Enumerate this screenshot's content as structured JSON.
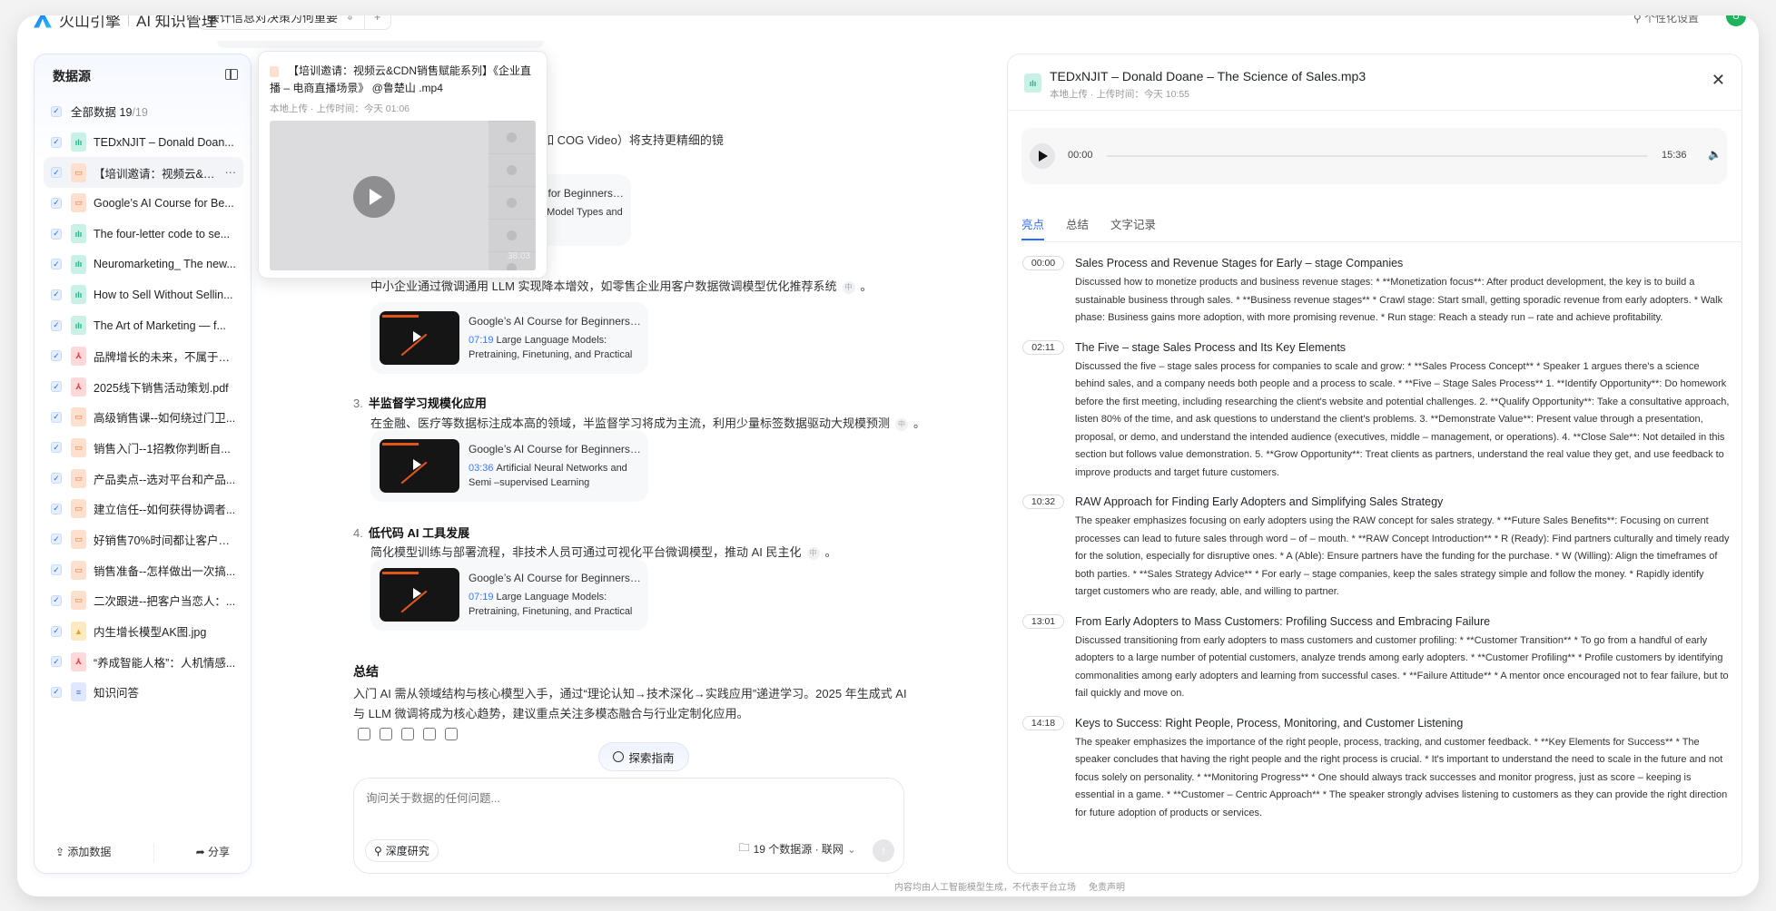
{
  "header": {
    "brand": "火山引擎",
    "app": "AI 知识管理",
    "session_tab": "会计信息对决策为何重要",
    "add_tab": "+",
    "personalize": "个性化设置",
    "avatar": "U"
  },
  "sidebar": {
    "title": "数据源",
    "all": {
      "label": "全部数据",
      "selected": "19",
      "total": "/19"
    },
    "items": [
      {
        "name": "TEDxNJIT – Donald Doan...",
        "type": "audio"
      },
      {
        "name": "【培训邀请：视频云&C...",
        "type": "video",
        "active": true,
        "more": "···"
      },
      {
        "name": "Google’s AI Course for Be...",
        "type": "video"
      },
      {
        "name": "The four-letter code to se...",
        "type": "audio"
      },
      {
        "name": "Neuromarketing_ The new...",
        "type": "audio"
      },
      {
        "name": "How to Sell Without Sellin...",
        "type": "audio"
      },
      {
        "name": "The Art of Marketing — f...",
        "type": "audio"
      },
      {
        "name": "品牌增长的未来，不属于渠...",
        "type": "pdf"
      },
      {
        "name": "2025线下销售活动策划.pdf",
        "type": "pdf"
      },
      {
        "name": "高级销售课--如何绕过门卫...",
        "type": "video"
      },
      {
        "name": "销售入门--1招教你判断自...",
        "type": "video"
      },
      {
        "name": "产品卖点--选对平台和产品...",
        "type": "video"
      },
      {
        "name": "建立信任--如何获得协调者...",
        "type": "video"
      },
      {
        "name": "好销售70%时间都让客户说...",
        "type": "video"
      },
      {
        "name": "销售准备--怎样做出一次搞...",
        "type": "video"
      },
      {
        "name": "二次跟进--把客户当恋人：...",
        "type": "video"
      },
      {
        "name": "内生增长模型AK图.jpg",
        "type": "image"
      },
      {
        "name": "“养成智能人格”：人机情感...",
        "type": "pdf"
      },
      {
        "name": "知识问答",
        "type": "doc"
      }
    ],
    "add_data": "添加数据",
    "share": "分享"
  },
  "popover": {
    "title": "【培训邀请：视频云&CDN销售赋能系列】《企业直播 – 电商直播场景》 @鲁楚山 .mp4",
    "meta": "本地上传 · 上传时间：今天 01:06",
    "duration": "38:03"
  },
  "main": {
    "line1": "进一步整合，例如文本到视频工具（如 COG Video）将支持更精细的镜",
    "card1": {
      "title": "Google’s AI Course for Beginners (i...",
      "time": "",
      "sub": "Generative AI: Patter Model Types and Dis..."
    },
    "line2": "中小企业通过微调通用 LLM 实现降本增效，如零售企业用客户数据微调模型优化推荐系统",
    "card2": {
      "title": "Google’s AI Course for Beginners (i...",
      "time": "07:19",
      "sub": "Large Language Models: Pretraining, Finetuning, and Practical Applic..."
    },
    "s3": {
      "num": "3.",
      "title": "半监督学习规模化应用",
      "desc": "在金融、医疗等数据标注成本高的领域，半监督学习将成为主流，利用少量标签数据驱动大规模预测"
    },
    "card3": {
      "title": "Google’s AI Course for Beginners (i...",
      "time": "03:36",
      "sub": "Artificial Neural Networks and Semi –supervised Learning"
    },
    "s4": {
      "num": "4.",
      "title": "低代码 AI 工具发展",
      "desc": "简化模型训练与部署流程，非技术人员可通过可视化平台微调模型，推动 AI 民主化"
    },
    "card4": {
      "title": "Google’s AI Course for Beginners (i...",
      "time": "07:19",
      "sub": "Large Language Models: Pretraining, Finetuning, and Practical Applic..."
    },
    "ref": "中",
    "period": "。",
    "summary_title": "总结",
    "summary": "入门 AI 需从领域结构与核心模型入手，通过“理论认知→技术深化→实践应用”递进学习。2025 年生成式 AI 与 LLM 微调将成为核心趋势，建议重点关注多模态融合与行业定制化应用。",
    "explore": "探索指南",
    "input_placeholder": "询问关于数据的任何问题...",
    "deep_research": "深度研究",
    "sources": "19 个数据源 · 联网",
    "send": "↑",
    "footer": "内容均由人工智能模型生成，不代表平台立场",
    "disclaimer": "免责声明"
  },
  "panel": {
    "title": "TEDxNJIT – Donald Doane – The Science of Sales.mp3",
    "meta": "本地上传 · 上传时间：今天 10:55",
    "close": "✕",
    "player": {
      "current": "00:00",
      "duration": "15:36",
      "progress": 0
    },
    "tabs": [
      "亮点",
      "总结",
      "文字记录"
    ],
    "active_tab": "亮点",
    "highlights": [
      {
        "time": "00:00",
        "title": "Sales Process and Revenue Stages for Early – stage Companies",
        "body": "Discussed how to monetize products and business revenue stages: * **Monetization focus**: After product development, the key is to build a sustainable business through sales. * **Business revenue stages** * Crawl stage: Start small, getting sporadic revenue from early adopters. * Walk phase: Business gains more adoption, with more promising revenue. * Run stage: Reach a steady run – rate and achieve profitability."
      },
      {
        "time": "02:11",
        "title": "The Five – stage Sales Process and Its Key Elements",
        "body": "Discussed the five – stage sales process for companies to scale and grow: * **Sales Process Concept** * Speaker 1 argues there's a science behind sales, and a company needs both people and a process to scale. * **Five – Stage Sales Process** 1. **Identify Opportunity**: Do homework before the first meeting, including researching the client's website and potential challenges. 2. **Qualify Opportunity**: Take a consultative approach, listen 80% of the time, and ask questions to understand the client's problems. 3. **Demonstrate Value**: Present value through a presentation, proposal, or demo, and understand the intended audience (executives, middle – management, or operations). 4. **Close Sale**: Not detailed in this section but follows value demonstration. 5. **Grow Opportunity**: Treat clients as partners, understand the real value they get, and use feedback to improve products and target future customers."
      },
      {
        "time": "10:32",
        "title": "RAW Approach for Finding Early Adopters and Simplifying Sales Strategy",
        "body": "The speaker emphasizes focusing on early adopters using the RAW concept for sales strategy. * **Future Sales Benefits**: Focusing on current processes can lead to future sales through word – of – mouth. * **RAW Concept Introduction** * R (Ready): Find partners culturally and timely ready for the solution, especially for disruptive ones. * A (Able): Ensure partners have the funding for the purchase. * W (Willing): Align the timeframes of both parties. * **Sales Strategy Advice** * For early – stage companies, keep the sales strategy simple and follow the money. * Rapidly identify target customers who are ready, able, and willing to partner."
      },
      {
        "time": "13:01",
        "title": "From Early Adopters to Mass Customers: Profiling Success and Embracing Failure",
        "body": "Discussed transitioning from early adopters to mass customers and customer profiling: * **Customer Transition** * To go from a handful of early adopters to a large number of potential customers, analyze trends among early adopters. * **Customer Profiling** * Profile customers by identifying commonalities among early adopters and learning from successful cases. * **Failure Attitude** * A mentor once encouraged not to fear failure, but to fail quickly and move on."
      },
      {
        "time": "14:18",
        "title": "Keys to Success: Right People, Process, Monitoring, and Customer Listening",
        "body": "The speaker emphasizes the importance of the right people, process, tracking, and customer feedback. * **Key Elements for Success** * The speaker concludes that having the right people and the right process is crucial. * It's important to understand the need to scale in the future and not focus solely on personality. * **Monitoring Progress** * One should always track successes and monitor progress, just as score – keeping is essential in a game. * **Customer – Centric Approach** * The speaker strongly advises listening to customers as they can provide the right direction for future adoption of products or services."
      }
    ]
  }
}
